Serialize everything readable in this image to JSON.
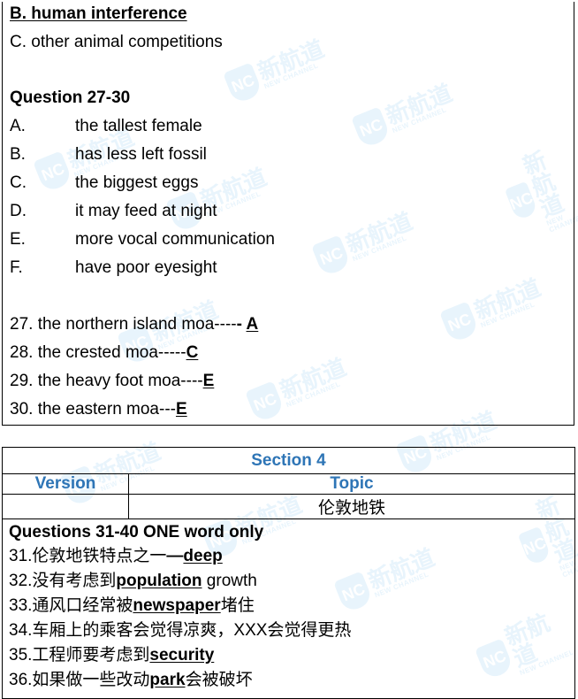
{
  "part1": {
    "prev_option_b": "B. human interference",
    "prev_option_c": "C. other animal competitions",
    "question_heading": "Question 27-30",
    "options": [
      {
        "letter": "A.",
        "text": "the tallest female"
      },
      {
        "letter": "B.",
        "text": "has less left fossil"
      },
      {
        "letter": "C.",
        "text": "the biggest eggs"
      },
      {
        "letter": "D.",
        "text": "it may feed at night"
      },
      {
        "letter": "E.",
        "text": "more vocal communication"
      },
      {
        "letter": "F.",
        "text": "have poor eyesight"
      }
    ],
    "answers": [
      {
        "prefix": "27. the northern island moa----",
        "dash": "- ",
        "answer": "A"
      },
      {
        "prefix": "28. the crested moa-----",
        "dash": "",
        "answer": "C"
      },
      {
        "prefix": "29. the heavy foot moa----",
        "dash": "",
        "answer": "E"
      },
      {
        "prefix": "30. the eastern moa---",
        "dash": "",
        "answer": "E"
      }
    ]
  },
  "section4": {
    "title": "Section 4",
    "version_header": "Version",
    "topic_header": "Topic",
    "version_value": "",
    "topic_value": "伦敦地铁",
    "instruction": "Questions 31-40 ONE word only",
    "items": [
      {
        "pre": "31.伦敦地铁特点之一",
        "dash": "—",
        "answer": "deep",
        "post": ""
      },
      {
        "pre": "32.没有考虑到",
        "dash": "",
        "answer": "population",
        "post": " growth"
      },
      {
        "pre": "33.通风口经常被",
        "dash": "",
        "answer": "newspaper",
        "post": "堵住"
      },
      {
        "pre": "34.车厢上的乘客会觉得凉爽，XXX会觉得更热",
        "dash": "",
        "answer": "",
        "post": ""
      },
      {
        "pre": "35.工程师要考虑到",
        "dash": "",
        "answer": "security",
        "post": ""
      },
      {
        "pre": "36.如果做一些改动",
        "dash": "",
        "answer": "park",
        "post": "会被破坏"
      }
    ]
  },
  "watermark": {
    "logo": "NC",
    "cn": "新航道",
    "en": "NEW CHANNEL",
    "color": "#bfe1f7"
  },
  "colors": {
    "heading_blue": "#2e75b6"
  }
}
